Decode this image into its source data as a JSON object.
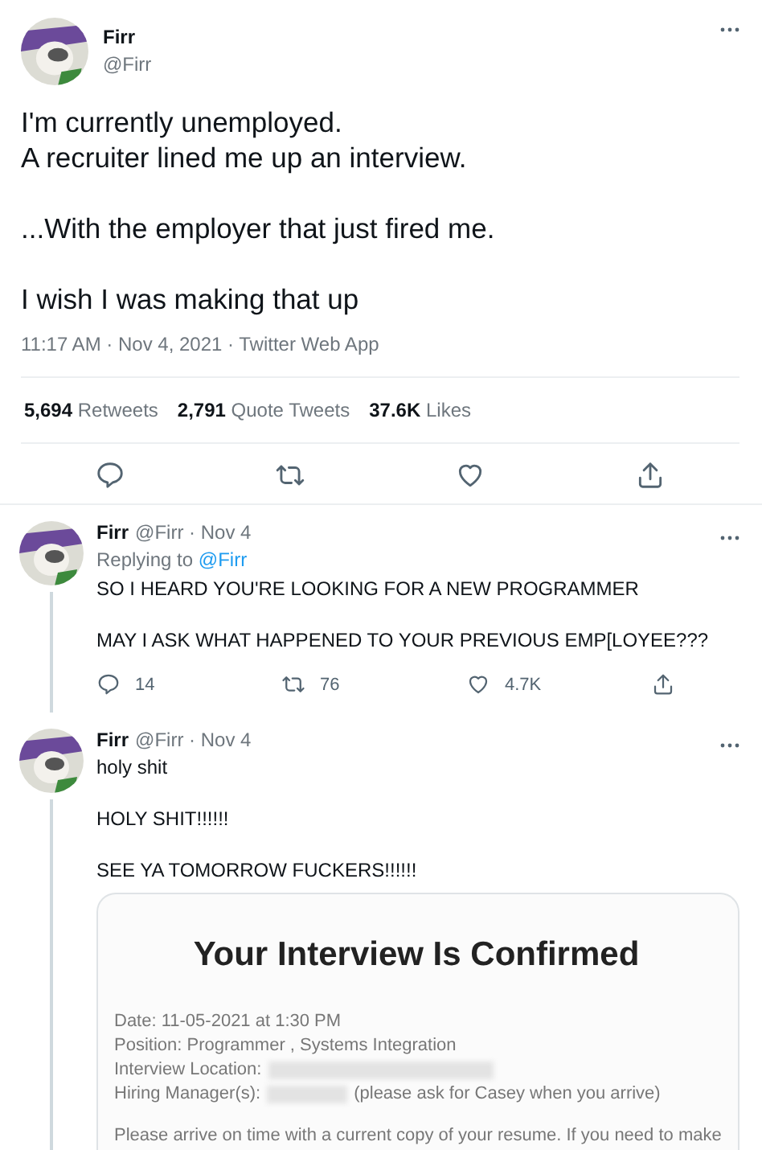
{
  "tweet": {
    "author": {
      "name": "Firr",
      "handle": "@Firr"
    },
    "paragraphs": [
      "I'm currently unemployed.\nA recruiter lined me up an interview.",
      "...With the employer that just fired me.",
      "I wish I was making that up"
    ],
    "meta": "11:17 AM · Nov 4, 2021 · Twitter Web App",
    "stats": [
      {
        "count": "5,694",
        "label": "Retweets"
      },
      {
        "count": "2,791",
        "label": "Quote Tweets"
      },
      {
        "count": "37.6K",
        "label": "Likes"
      }
    ],
    "actions": [
      {
        "kind": "reply"
      },
      {
        "kind": "retweet"
      },
      {
        "kind": "like"
      },
      {
        "kind": "share"
      }
    ]
  },
  "replies": [
    {
      "name": "Firr",
      "meta": "@Firr · Nov 4",
      "replying_to": {
        "prefix": "Replying to",
        "handle": "@Firr"
      },
      "paragraphs": [
        "SO I HEARD YOU'RE LOOKING FOR A NEW PROGRAMMER",
        "MAY I ASK WHAT HAPPENED TO YOUR PREVIOUS EMP[LOYEE???"
      ],
      "actions": [
        {
          "kind": "reply",
          "count": "14"
        },
        {
          "kind": "retweet",
          "count": "76"
        },
        {
          "kind": "like",
          "count": "4.7K"
        },
        {
          "kind": "share"
        }
      ]
    },
    {
      "name": "Firr",
      "meta": "@Firr · Nov 4",
      "paragraphs": [
        "holy shit",
        "HOLY SHIT!!!!!!",
        "SEE YA TOMORROW FUCKERS!!!!!!"
      ],
      "attachment": {
        "title": "Your Interview Is Confirmed",
        "lines": [
          {
            "text": "Date: 11-05-2021 at 1:30 PM"
          },
          {
            "text": "Position: Programmer , Systems Integration"
          },
          {
            "text": "Interview Location:",
            "redacted": true
          },
          {
            "text": "Hiring Manager(s):",
            "redacted": true,
            "after": "(please ask for Casey when you arrive)"
          }
        ],
        "note": "Please arrive on time with a current copy of your resume.  If you need to make"
      }
    }
  ]
}
